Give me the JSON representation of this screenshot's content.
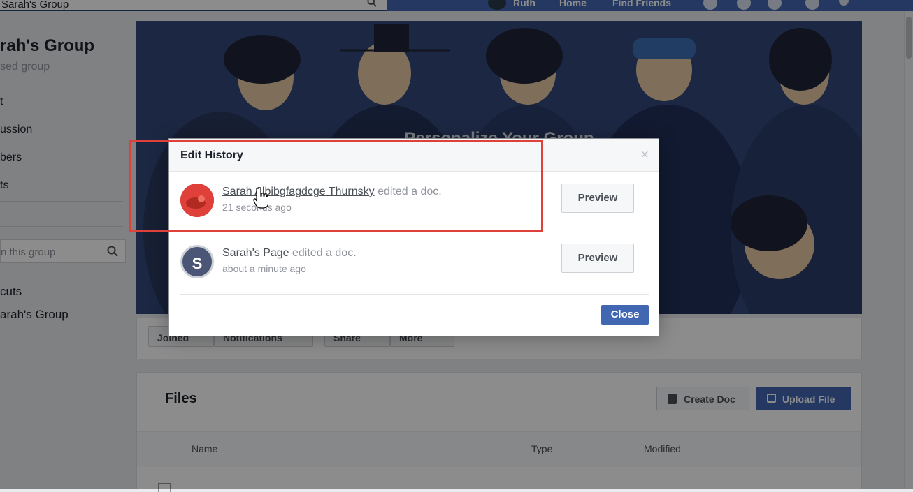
{
  "topbar": {
    "search_value": "Sarah's Group",
    "profile_name": "Ruth",
    "home": "Home",
    "find_friends": "Find Friends"
  },
  "sidebar": {
    "group_name": "rah's Group",
    "group_type": "sed group",
    "items": [
      {
        "label": "t"
      },
      {
        "label": "ussion"
      },
      {
        "label": "bers"
      },
      {
        "label": "ts"
      }
    ],
    "search_placeholder": "n this group",
    "shortcuts_label": "cuts",
    "shortcut_item": "arah's Group"
  },
  "cover": {
    "title": "Personalize Your Group"
  },
  "actions": {
    "joined": "Joined",
    "notifications": "Notifications",
    "share": "Share",
    "more": "More"
  },
  "files": {
    "title": "Files",
    "create_doc": "Create Doc",
    "upload_file": "Upload File",
    "columns": [
      "Name",
      "Type",
      "Modified"
    ]
  },
  "modal": {
    "title": "Edit History",
    "close_x": "×",
    "entries": [
      {
        "name": "Sarah Albibgfagdcge Thurnsky",
        "action": " edited a doc.",
        "time": "21 seconds ago",
        "preview": "Preview",
        "avatar_color": "#e0403a",
        "avatar_letter": ""
      },
      {
        "name": "Sarah's Page",
        "action": " edited a doc.",
        "time": "about a minute ago",
        "preview": "Preview",
        "avatar_color": "#4b5575",
        "avatar_letter": "S"
      }
    ],
    "close_button": "Close"
  },
  "colors": {
    "brand": "#4267b2",
    "highlight": "#e0403a"
  }
}
